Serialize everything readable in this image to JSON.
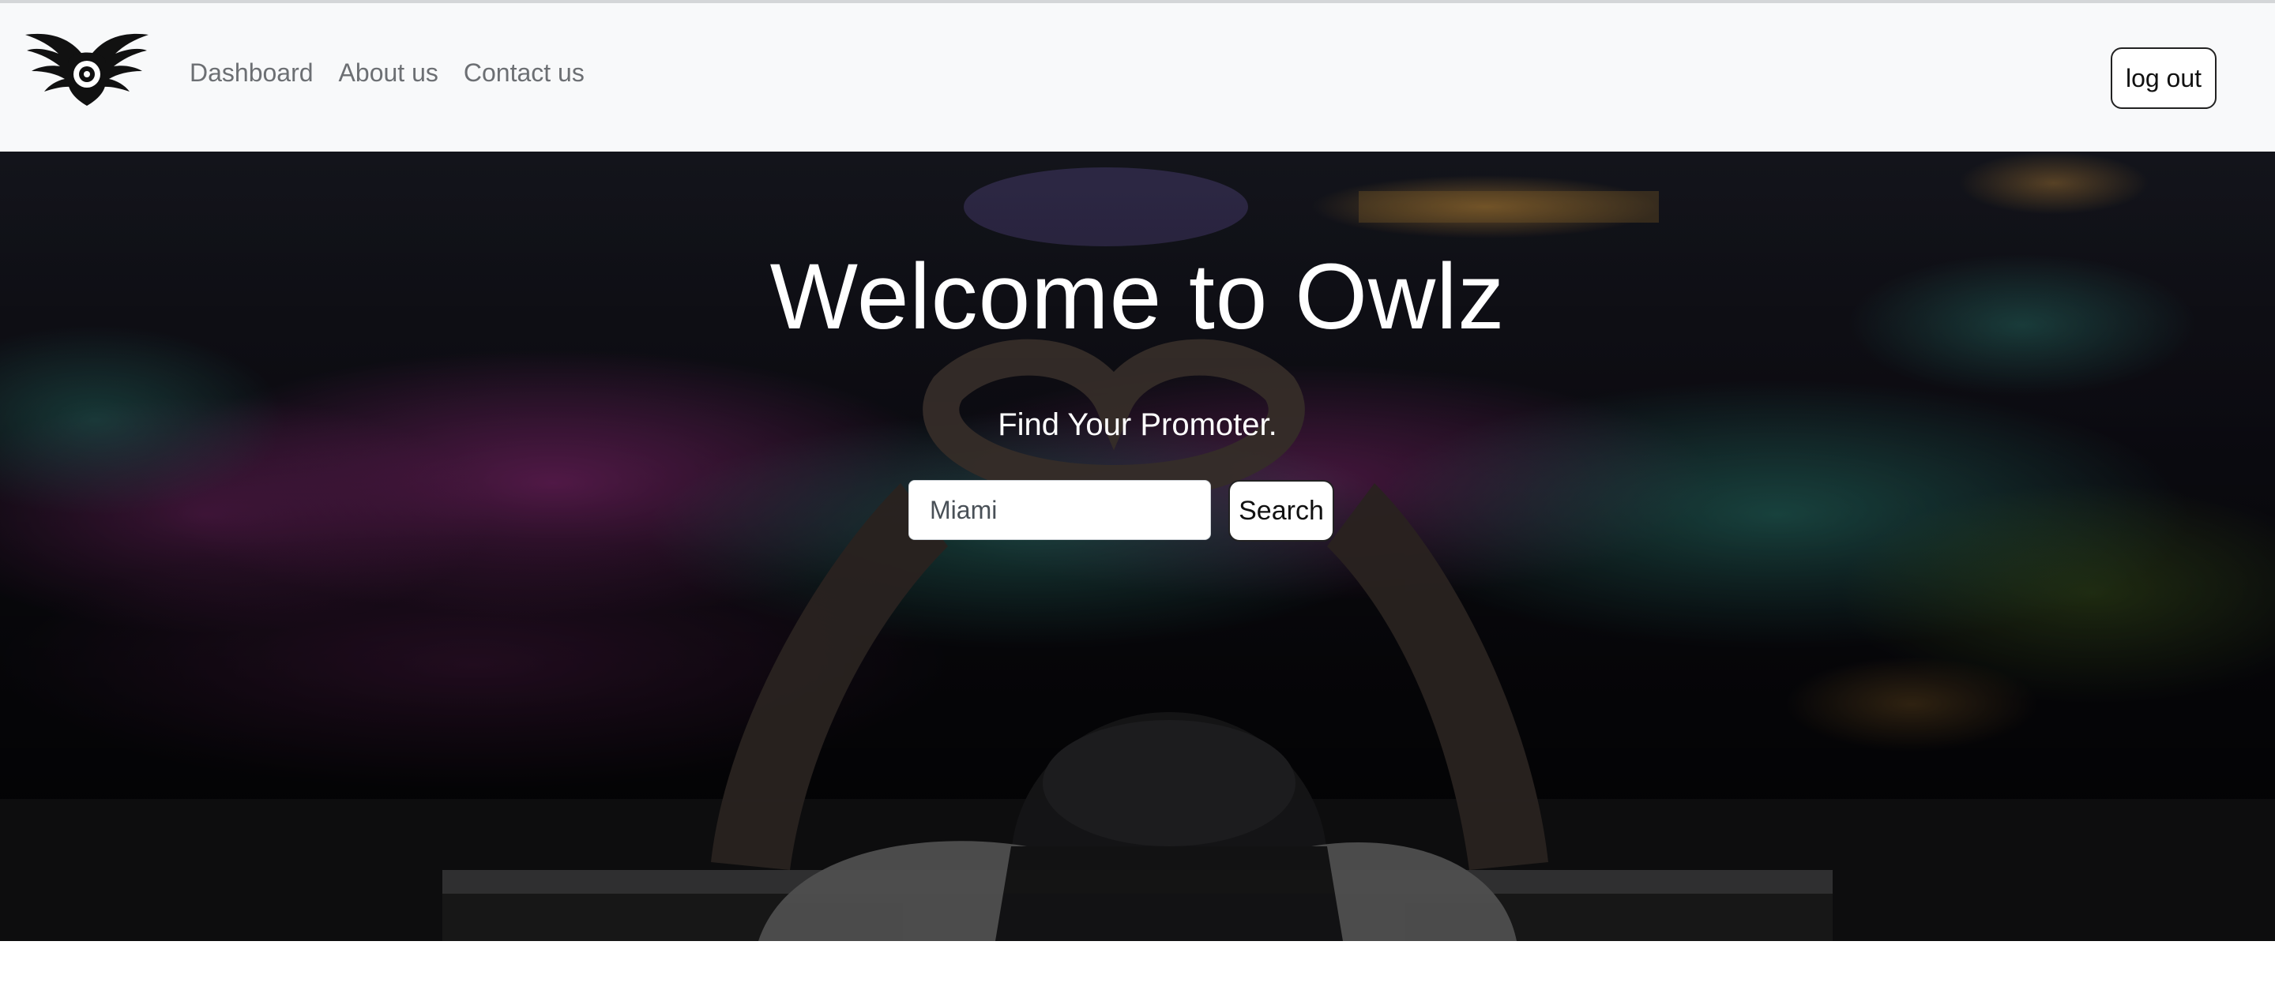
{
  "navbar": {
    "logo_icon": "owl-wings-logo-icon",
    "links": [
      {
        "label": "Dashboard"
      },
      {
        "label": "About us"
      },
      {
        "label": "Contact us"
      }
    ],
    "logout_label": "log out"
  },
  "hero": {
    "background": "concert-crowd-heart-hands-photo",
    "title": "Welcome to Owlz",
    "subtitle": "Find Your Promoter.",
    "search": {
      "value": "Miami",
      "button_label": "Search"
    }
  },
  "colors": {
    "navbar_bg": "#f8f9fa",
    "nav_link": "#6c6f73",
    "hero_text": "#ffffff",
    "crowd_magenta": "#b0309a",
    "crowd_teal": "#3fb8a8"
  }
}
